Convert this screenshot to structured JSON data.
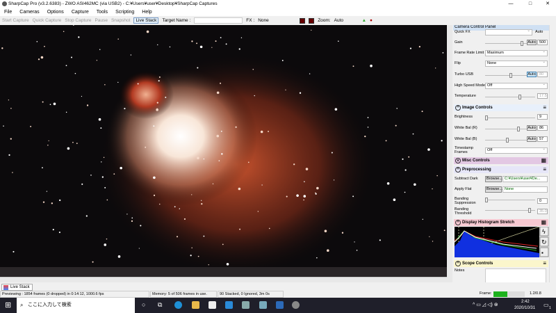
{
  "window": {
    "title": "SharpCap Pro (v3.2.6383) - ZWO ASI462MC (via USB2) - C:¥Users¥user¥Desktop¥SharpCap Captures",
    "minimize": "—",
    "maximize": "□",
    "close": "✕"
  },
  "menu": [
    "File",
    "Cameras",
    "Options",
    "Capture",
    "Tools",
    "Scripting",
    "Help"
  ],
  "toolbar": {
    "start_capture": "Start Capture",
    "quick_capture": "Quick Capture",
    "stop_capture": "Stop Capture",
    "pause": "Pause",
    "snapshot": "Snapshot",
    "live_stack": "Live Stack",
    "target_name_label": "Target Name :",
    "fx_label": "FX :",
    "fx_value": "None",
    "zoom_label": "Zoom:",
    "zoom_value": "Auto"
  },
  "panel": {
    "title": "Camera Control Panel",
    "quick_fx": "Quick FX",
    "quick_fx_auto": "Auto",
    "gain": {
      "label": "Gain",
      "auto": "Auto",
      "value": "500",
      "level": 0.85
    },
    "frame_rate_limit": {
      "label": "Frame Rate Limit",
      "value": "Maximum"
    },
    "flip": {
      "label": "Flip",
      "value": "None"
    },
    "turbo_usb": {
      "label": "Turbo USB",
      "auto": "Auto",
      "value": "80",
      "level": 0.75
    },
    "high_speed_mode": {
      "label": "High Speed Mode",
      "value": "Off"
    },
    "temperature": {
      "label": "Temperature",
      "value": "17.5",
      "level": 0.95
    },
    "image_controls": "Image Controls",
    "brightness": {
      "label": "Brightness",
      "value": "9",
      "level": 0.02
    },
    "wb_r": {
      "label": "White Bal (R)",
      "auto": "Auto",
      "value": "86",
      "level": 0.85
    },
    "wb_b": {
      "label": "White Bal (B)",
      "auto": "Auto",
      "value": "57",
      "level": 0.55
    },
    "timestamp": {
      "label": "Timestamp Frames",
      "value": "Off"
    },
    "misc_controls": "Misc Controls",
    "preprocessing": "Preprocessing",
    "subtract_dark": {
      "label": "Subtract Dark",
      "browse": "Browse...",
      "value": "C:¥Users¥user¥De..."
    },
    "apply_flat": {
      "label": "Apply Flat",
      "browse": "Browse...",
      "value": "None"
    },
    "banding_suppression": {
      "label": "Banding Suppression",
      "value": "0",
      "level": 0
    },
    "banding_threshold": {
      "label": "Banding Threshold",
      "value": "35.0",
      "level": 0.9
    },
    "histogram": "Display Histogram Stretch",
    "scope_controls": "Scope Controls",
    "notes": "Notes"
  },
  "tab": {
    "live_stack": "Live Stack"
  },
  "status": {
    "preview": "Previewing : 1854 frames (0 dropped) in 0:14:12, 1000.6 fps",
    "memory": "Memory: 5 of 506 frames in use.",
    "stacked": "90 Stacked, 0 Ignored, 3m 0s",
    "frame_label": "Frame:",
    "frame_value": "1.2/0.8",
    "frame_fill": 0.45
  },
  "taskbar": {
    "search_placeholder": "ここに入力して検索",
    "time": "2:42",
    "date": "2020/10/31",
    "notif_count": "1"
  }
}
